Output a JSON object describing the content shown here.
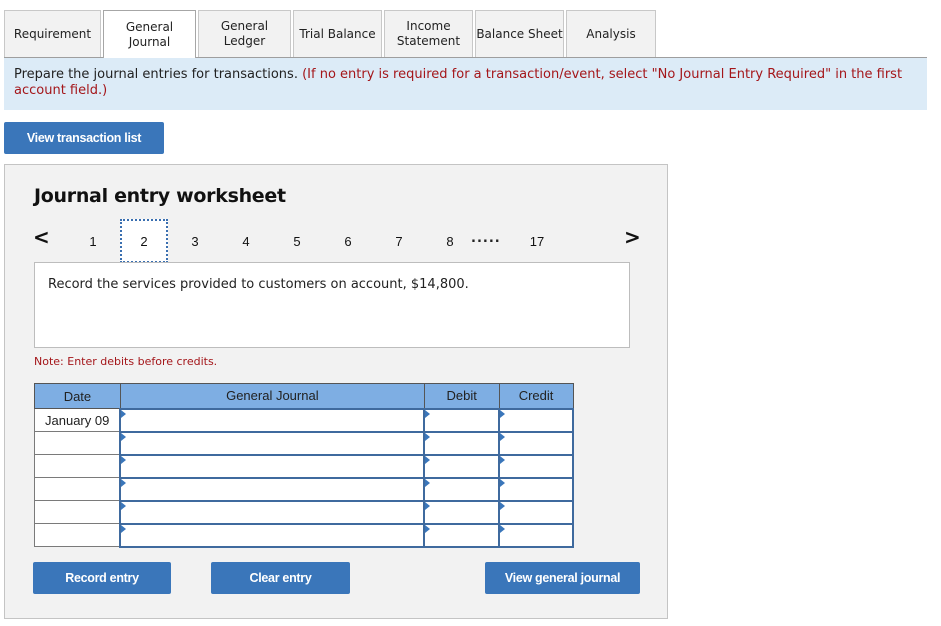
{
  "tabs": [
    {
      "label": [
        "Requirement"
      ],
      "active": false
    },
    {
      "label": [
        "General",
        "Journal"
      ],
      "active": true
    },
    {
      "label": [
        "General",
        "Ledger"
      ],
      "active": false
    },
    {
      "label": [
        "Trial Balance"
      ],
      "active": false
    },
    {
      "label": [
        "Income",
        "Statement"
      ],
      "active": false
    },
    {
      "label": [
        "Balance Sheet"
      ],
      "active": false
    },
    {
      "label": [
        "Analysis"
      ],
      "active": false
    }
  ],
  "banner": {
    "instruction": "Prepare the journal entries for transactions. ",
    "hint": "(If no entry is required for a transaction/event, select \"No Journal Entry Required\" in the first account field.)"
  },
  "buttons": {
    "view_transaction_list": "View transaction list",
    "record_entry": "Record entry",
    "clear_entry": "Clear entry",
    "view_general_journal": "View general journal"
  },
  "worksheet": {
    "title": "Journal entry worksheet",
    "pager": {
      "prev_icon": "chevron-left-icon",
      "next_icon": "chevron-right-icon",
      "prev_glyph": "<",
      "next_glyph": ">",
      "pages": [
        "1",
        "2",
        "3",
        "4",
        "5",
        "6",
        "7",
        "8"
      ],
      "ellipsis": ".....",
      "last_page": "17",
      "current_page": "2"
    },
    "description": "Record the services provided to customers on account, $14,800.",
    "note": "Note: Enter debits before credits."
  },
  "journal_table": {
    "headers": {
      "date": "Date",
      "general_journal": "General Journal",
      "debit": "Debit",
      "credit": "Credit"
    },
    "rows": [
      {
        "date": "January 09",
        "account": "",
        "debit": "",
        "credit": ""
      },
      {
        "date": "",
        "account": "",
        "debit": "",
        "credit": ""
      },
      {
        "date": "",
        "account": "",
        "debit": "",
        "credit": ""
      },
      {
        "date": "",
        "account": "",
        "debit": "",
        "credit": ""
      },
      {
        "date": "",
        "account": "",
        "debit": "",
        "credit": ""
      },
      {
        "date": "",
        "account": "",
        "debit": "",
        "credit": ""
      }
    ]
  },
  "colors": {
    "button_blue": "#3a76ba",
    "table_header": "#7eaee3",
    "banner_bg": "#dcebf7",
    "hint_red": "#a4161a",
    "panel_bg": "#f2f2f2"
  }
}
